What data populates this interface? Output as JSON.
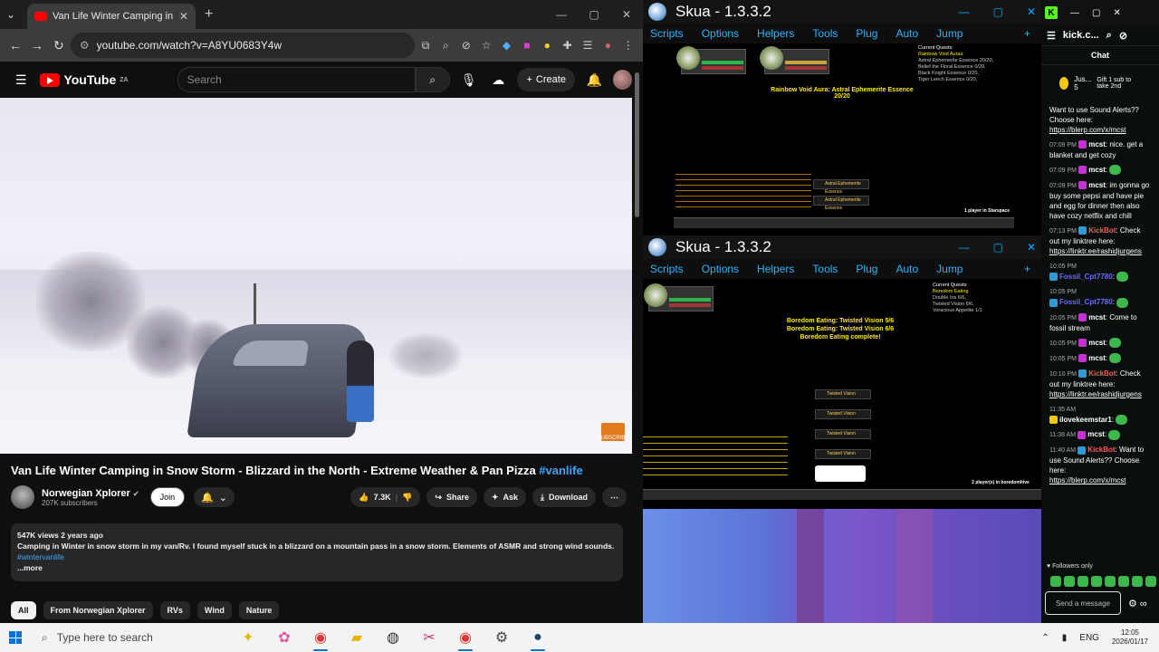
{
  "chrome": {
    "tab_title": "Van Life Winter Camping in",
    "url": "youtube.com/watch?v=A8YU0683Y4w"
  },
  "youtube": {
    "logo": "YouTube",
    "region": "ZA",
    "search_placeholder": "Search",
    "create_label": "Create",
    "video_title": "Van Life Winter Camping in Snow Storm - Blizzard in the North - Extreme Weather & Pan Pizza",
    "hashtag": "#vanlife",
    "channel_name": "Norwegian Xplorer",
    "subscribers": "207K subscribers",
    "join_label": "Join",
    "likes": "7.3K",
    "share_label": "Share",
    "ask_label": "Ask",
    "download_label": "Download",
    "views_date": "547K views  2 years ago",
    "description": "Camping in Winter in snow storm in my van/Rv. I found myself stuck in a blizzard on a mountain pass in a snow storm. Elements of ASMR and strong wind sounds.",
    "desc_hashtag": "#wintervanlife",
    "more_label": "...more",
    "subscribe_watermark": "SUBSCRIBE",
    "chips": [
      "All",
      "From Norwegian Xplorer",
      "RVs",
      "Wind",
      "Nature"
    ]
  },
  "skua_top": {
    "title": "Skua - 1.3.3.2",
    "menu": [
      "Scripts",
      "Options",
      "Helpers",
      "Tools",
      "Plug",
      "Auto",
      "Jump"
    ],
    "aura_text": "Rainbow Void Aura: Astral Ephemerite Essence 20/20",
    "quest_header": "Current Quests:",
    "quest_lines": [
      "Rainbow Void Auras",
      "Astral Ephemerite Essence 20/20,",
      "Belief the Floral Essence 0/20,",
      "Black Knight Essence 0/20,",
      "Tiger Leech Essence 0/20,"
    ],
    "loot_items": [
      "Astral Ephemerite Essence",
      "Astral Ephemerite Essence"
    ],
    "players": "1 player in Starspace"
  },
  "skua_bottom": {
    "title": "Skua - 1.3.3.2",
    "menu": [
      "Scripts",
      "Options",
      "Helpers",
      "Tools",
      "Plug",
      "Auto",
      "Jump"
    ],
    "boredom_lines": [
      "Boredom Eating: Twisted Vision 5/6",
      "Boredom Eating: Twisted Vision 6/6",
      "Boredom Eating complete!"
    ],
    "quest_header": "Current Quests:",
    "quest_lines": [
      "Boredom Eating",
      "Double Iris 6/6,",
      "Twisted Vision 6/6,",
      "Voracious Appetite 1/1"
    ],
    "loot_items": [
      "Twisted Vision",
      "Twisted Vision",
      "Twisted Vision",
      "Twisted Vision"
    ],
    "players": "2 player(s) in boredomhive"
  },
  "kick": {
    "channel": "kick.c...",
    "chat_title": "Chat",
    "gift_user": "Jus...",
    "gift_count": "5",
    "gift_text": "Gift 1 sub to take 2nd",
    "messages": [
      {
        "time": "",
        "user": "",
        "text": "Want to use Sound Alerts?? Choose here:",
        "link": "https://blerp.com/x/mcst"
      },
      {
        "time": "07:09 PM",
        "user": "mcst",
        "text": "nice. get a blanket and get cozy",
        "link": ""
      },
      {
        "time": "07:09 PM",
        "user": "mcst",
        "text": "",
        "link": ""
      },
      {
        "time": "07:09 PM",
        "user": "mcst",
        "text": "im gonna go buy some pepsi and have pie and egg for dinner then also have cozy netflix and chill",
        "link": ""
      },
      {
        "time": "07:13 PM",
        "user": "KickBot",
        "text": "Check out my linktree here:",
        "link": "https://linktr.ee/rashidjurgens"
      },
      {
        "time": "10:05 PM",
        "user": "Fossil_Cpt7780",
        "text": "",
        "link": ""
      },
      {
        "time": "10:05 PM",
        "user": "Fossil_Cpt7780",
        "text": "",
        "link": ""
      },
      {
        "time": "10:05 PM",
        "user": "mcst",
        "text": "Come to fossil stream",
        "link": ""
      },
      {
        "time": "10:05 PM",
        "user": "mcst",
        "text": "",
        "link": ""
      },
      {
        "time": "10:05 PM",
        "user": "mcst",
        "text": "",
        "link": ""
      },
      {
        "time": "10:10 PM",
        "user": "KickBot",
        "text": "Check out my linktree here:",
        "link": "https://linktr.ee/rashidjurgens"
      },
      {
        "time": "11:35 AM",
        "user": "ilovekeemstar1",
        "text": "",
        "link": ""
      },
      {
        "time": "11:38 AM",
        "user": "mcst",
        "text": "",
        "link": ""
      },
      {
        "time": "11:40 AM",
        "user": "KickBot",
        "text": "Want to use Sound Alerts?? Choose here:",
        "link": "https://blerp.com/x/mcst"
      }
    ],
    "followers_only": "Followers only",
    "send_placeholder": "Send a message"
  },
  "taskbar": {
    "search_placeholder": "Type here to search",
    "lang": "ENG",
    "time": "12:05",
    "date": "2026/01/17"
  },
  "colors": {
    "kick_green": "#53fc18",
    "yt_red": "#ff0000",
    "skua_blue": "#2cb5ff"
  }
}
